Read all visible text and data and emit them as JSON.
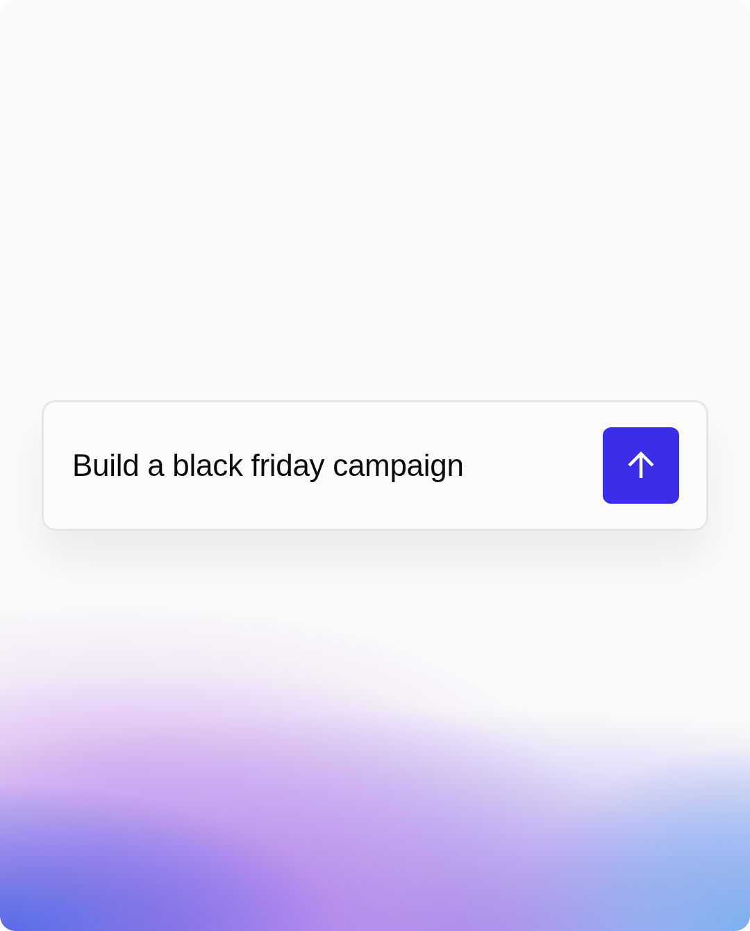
{
  "prompt": {
    "value": "Build a black friday campaign"
  }
}
